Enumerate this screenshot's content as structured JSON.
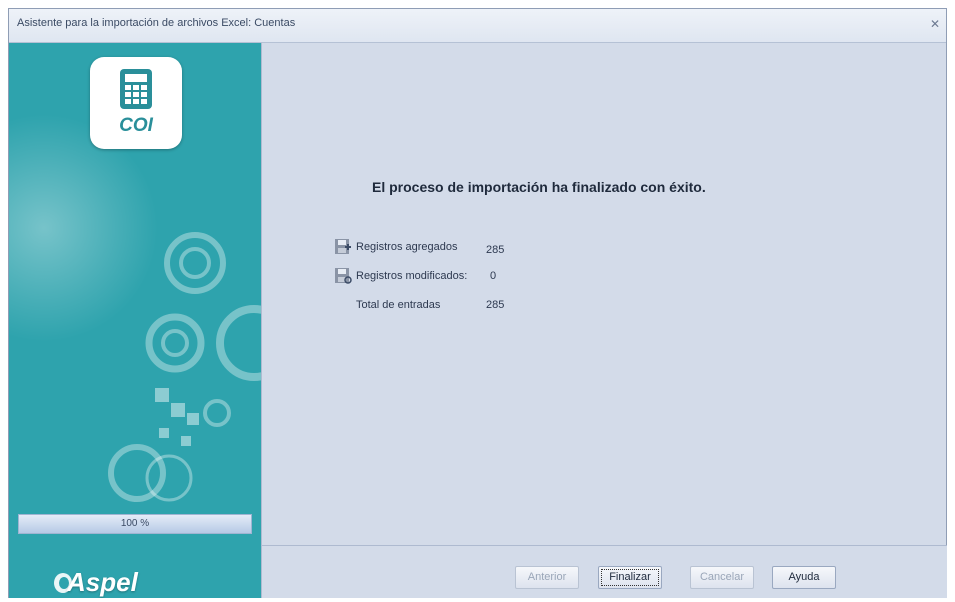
{
  "window": {
    "title": "Asistente para la importación de archivos Excel: Cuentas",
    "close_icon": "close-icon"
  },
  "sidebar": {
    "logo_label": "COI",
    "progress_text": "100 %",
    "progress_value": 1.0,
    "brand": "Aspel"
  },
  "main": {
    "heading": "El proceso de importación ha finalizado con éxito.",
    "rows": [
      {
        "icon": "save-add-icon",
        "label": "Registros agregados",
        "value": "285"
      },
      {
        "icon": "save-edit-icon",
        "label": "Registros modificados:",
        "value": "0"
      },
      {
        "icon": "",
        "label": "Total de entradas",
        "value": "285"
      }
    ]
  },
  "footer": {
    "back_label": "Anterior",
    "finish_label": "Finalizar",
    "cancel_label": "Cancelar",
    "help_label": "Ayuda"
  },
  "colors": {
    "sidebar": "#2ea3ad",
    "panel": "#d3dbe9",
    "accent_text": "#1f2a3c"
  }
}
